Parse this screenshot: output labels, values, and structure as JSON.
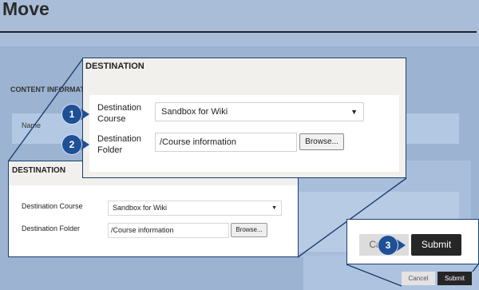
{
  "page": {
    "title": "Move",
    "content_section_label": "CONTENT INFORMATION",
    "name_label": "Name"
  },
  "destination_zoom": {
    "title": "DESTINATION",
    "course_label": "Destination Course",
    "course_value": "Sandbox for Wiki",
    "folder_label": "Destination Folder",
    "folder_value": "/Course information",
    "browse_label": "Browse..."
  },
  "destination_small": {
    "title": "DESTINATION",
    "course_label": "Destination Course",
    "course_value": "Sandbox for Wiki",
    "folder_label": "Destination Folder",
    "folder_value": "/Course information",
    "browse_label": "Browse..."
  },
  "buttons_zoom": {
    "cancel_label": "Cancel",
    "submit_label": "Submit"
  },
  "buttons_small": {
    "cancel_label": "Cancel",
    "submit_label": "Submit"
  },
  "callouts": {
    "one": "1",
    "two": "2",
    "three": "3"
  },
  "colors": {
    "callout_blue": "#1f4f95",
    "submit_dark": "#262626",
    "page_overlay": "#9db4d3"
  },
  "icons": {
    "select_arrow": "chevron-down-icon"
  }
}
